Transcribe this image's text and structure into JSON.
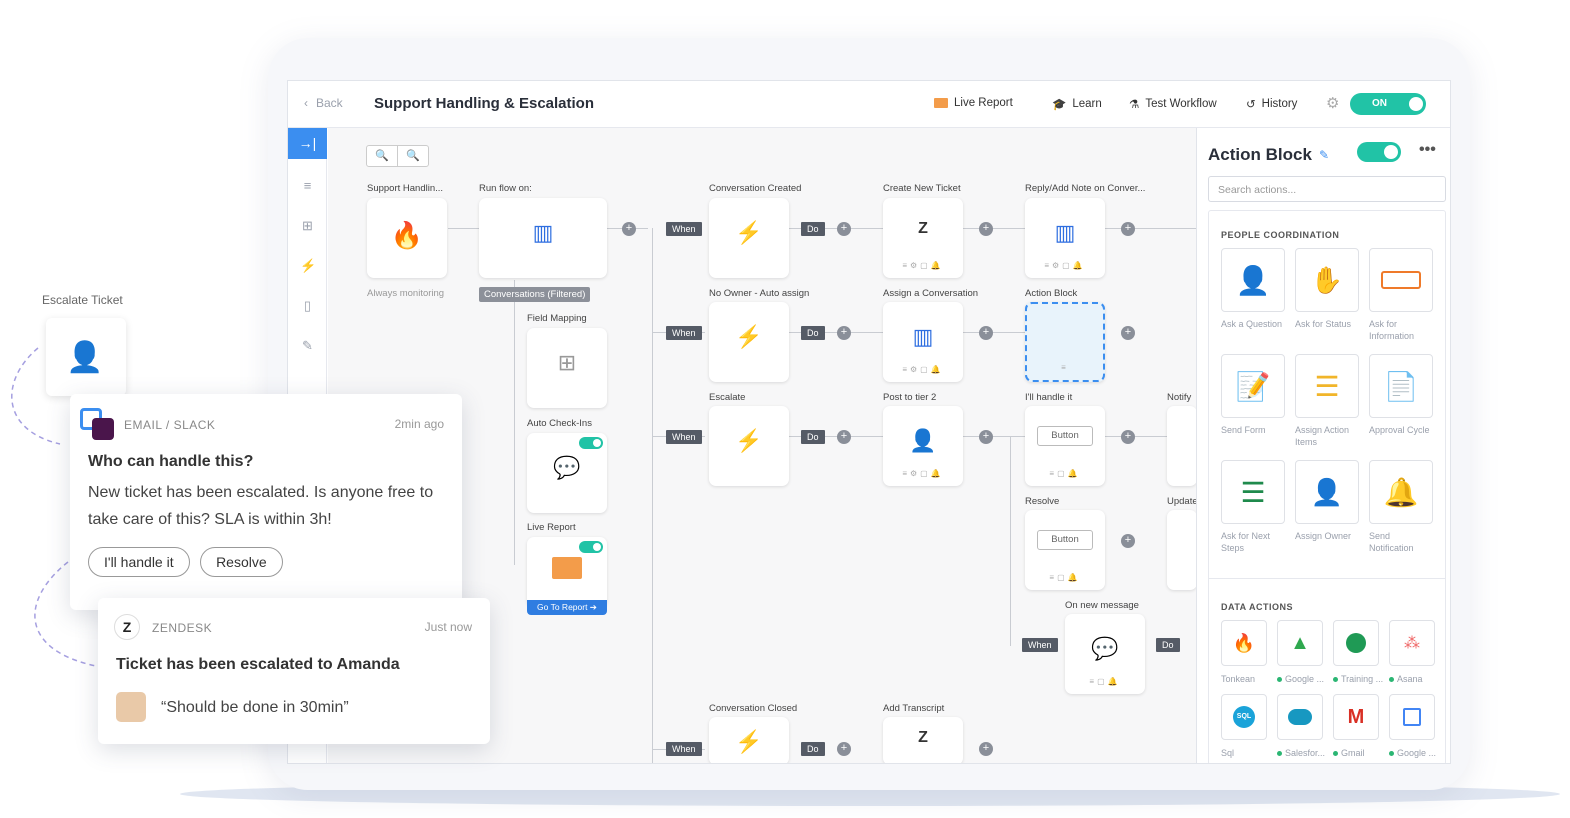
{
  "topbar": {
    "back_label": "Back",
    "title": "Support Handling & Escalation",
    "live_report": "Live Report",
    "learn": "Learn",
    "test_workflow": "Test Workflow",
    "history": "History",
    "toggle_label": "ON"
  },
  "canvas": {
    "nodes": {
      "trigger_label": "Support Handlin...",
      "trigger_caption": "Always monitoring",
      "run_flow_label": "Run flow on:",
      "run_flow_caption": "Conversations (Filtered)",
      "field_mapping": "Field Mapping",
      "auto_checkins": "Auto Check-Ins",
      "live_report": "Live Report",
      "go_to_report": "Go To Report ➔",
      "conv_created": "Conversation Created",
      "create_ticket": "Create New Ticket",
      "reply_note": "Reply/Add Note on Conver...",
      "no_owner": "No Owner - Auto assign",
      "assign_conv": "Assign a Conversation",
      "action_block": "Action Block",
      "escalate": "Escalate",
      "post_tier2": "Post to tier 2",
      "ill_handle": "I'll handle it",
      "notify": "Notify",
      "resolve": "Resolve",
      "update": "Update",
      "on_new_message": "On new message",
      "conv_closed": "Conversation Closed",
      "add_transcript": "Add Transcript",
      "button_label": "Button",
      "when": "When",
      "do": "Do"
    }
  },
  "right_panel": {
    "title": "Action Block",
    "search_placeholder": "Search actions...",
    "people_title": "PEOPLE COORDINATION",
    "people_actions": [
      {
        "label": "Ask a Question"
      },
      {
        "label": "Ask for Status"
      },
      {
        "label": "Ask for Information"
      },
      {
        "label": "Send Form"
      },
      {
        "label": "Assign Action Items"
      },
      {
        "label": "Approval Cycle"
      },
      {
        "label": "Ask for Next Steps"
      },
      {
        "label": "Assign Owner"
      },
      {
        "label": "Send Notification"
      }
    ],
    "data_title": "DATA ACTIONS",
    "data_actions": [
      {
        "label": "Tonkean"
      },
      {
        "label": "Google ..."
      },
      {
        "label": "Training ..."
      },
      {
        "label": "Asana"
      },
      {
        "label": "Sql"
      },
      {
        "label": "Salesfor..."
      },
      {
        "label": "Gmail"
      },
      {
        "label": "Google ..."
      }
    ]
  },
  "overlay": {
    "escalate_label": "Escalate Ticket",
    "card1": {
      "source": "EMAIL / SLACK",
      "time": "2min ago",
      "heading": "Who can handle this?",
      "body": "New ticket has been escalated. Is anyone free to take care of this? SLA is within 3h!",
      "btn1": "I'll handle it",
      "btn2": "Resolve"
    },
    "card2": {
      "source": "ZENDESK",
      "time": "Just now",
      "heading": "Ticket has been escalated to Amanda",
      "quote": "“Should be done in 30min”"
    }
  },
  "colors": {
    "accent": "#21c3a6",
    "blue": "#3b8ef0",
    "dark_pill": "#555b66"
  }
}
